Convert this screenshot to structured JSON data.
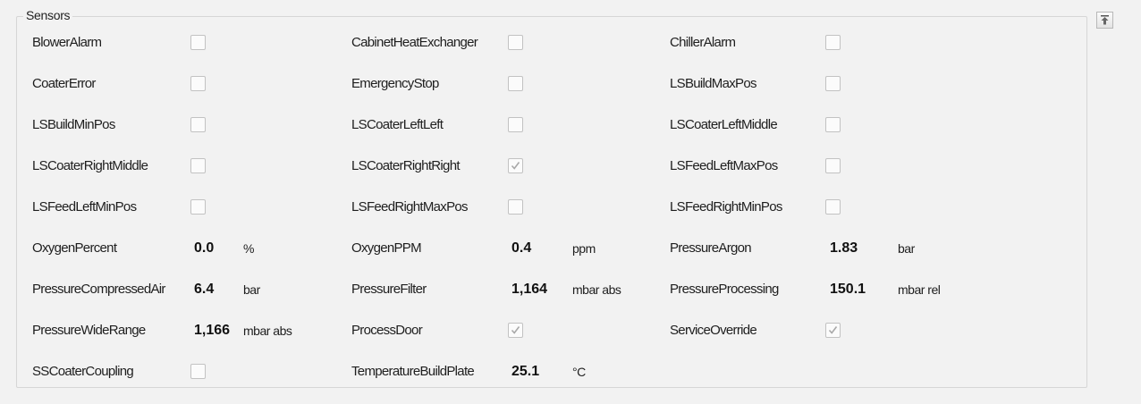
{
  "group": {
    "title": "Sensors"
  },
  "collapse_icon": "collapse-up-icon",
  "columns": [
    {
      "rows": [
        {
          "label": "BlowerAlarm",
          "type": "checkbox",
          "checked": false
        },
        {
          "label": "CoaterError",
          "type": "checkbox",
          "checked": false
        },
        {
          "label": "LSBuildMinPos",
          "type": "checkbox",
          "checked": false
        },
        {
          "label": "LSCoaterRightMiddle",
          "type": "checkbox",
          "checked": false
        },
        {
          "label": "LSFeedLeftMinPos",
          "type": "checkbox",
          "checked": false
        },
        {
          "label": "OxygenPercent",
          "type": "value",
          "value": "0.0",
          "unit": "%"
        },
        {
          "label": "PressureCompressedAir",
          "type": "value",
          "value": "6.4",
          "unit": "bar"
        },
        {
          "label": "PressureWideRange",
          "type": "value",
          "value": "1,166",
          "unit": "mbar abs"
        },
        {
          "label": "SSCoaterCoupling",
          "type": "checkbox",
          "checked": false
        }
      ]
    },
    {
      "rows": [
        {
          "label": "CabinetHeatExchanger",
          "type": "checkbox",
          "checked": false
        },
        {
          "label": "EmergencyStop",
          "type": "checkbox",
          "checked": false
        },
        {
          "label": "LSCoaterLeftLeft",
          "type": "checkbox",
          "checked": false
        },
        {
          "label": "LSCoaterRightRight",
          "type": "checkbox",
          "checked": true
        },
        {
          "label": "LSFeedRightMaxPos",
          "type": "checkbox",
          "checked": false
        },
        {
          "label": "OxygenPPM",
          "type": "value",
          "value": "0.4",
          "unit": "ppm"
        },
        {
          "label": "PressureFilter",
          "type": "value",
          "value": "1,164",
          "unit": "mbar abs"
        },
        {
          "label": "ProcessDoor",
          "type": "checkbox",
          "checked": true
        },
        {
          "label": "TemperatureBuildPlate",
          "type": "value",
          "value": "25.1",
          "unit": "°C"
        }
      ]
    },
    {
      "rows": [
        {
          "label": "ChillerAlarm",
          "type": "checkbox",
          "checked": false
        },
        {
          "label": "LSBuildMaxPos",
          "type": "checkbox",
          "checked": false
        },
        {
          "label": "LSCoaterLeftMiddle",
          "type": "checkbox",
          "checked": false
        },
        {
          "label": "LSFeedLeftMaxPos",
          "type": "checkbox",
          "checked": false
        },
        {
          "label": "LSFeedRightMinPos",
          "type": "checkbox",
          "checked": false
        },
        {
          "label": "PressureArgon",
          "type": "value",
          "value": "1.83",
          "unit": "bar"
        },
        {
          "label": "PressureProcessing",
          "type": "value",
          "value": "150.1",
          "unit": "mbar rel"
        },
        {
          "label": "ServiceOverride",
          "type": "checkbox",
          "checked": true
        }
      ]
    }
  ]
}
